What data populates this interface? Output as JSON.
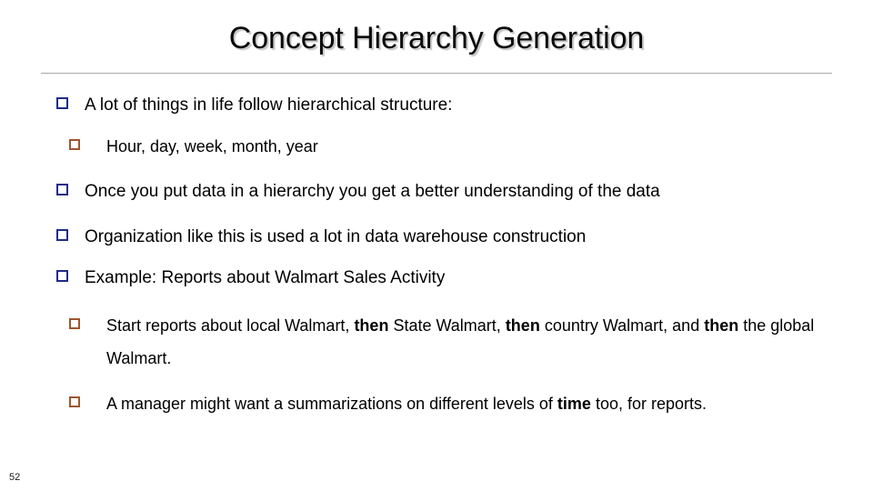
{
  "slide": {
    "title": "Concept Hierarchy Generation",
    "number": "52",
    "colors": {
      "background": "#ffffff",
      "text": "#000000",
      "title_text": "#0a0a0a",
      "title_shadow": "#969696",
      "rule": "#a8a8a8",
      "bullet_level1": "#1f2c87",
      "bullet_level2": "#a0562f"
    },
    "bullets": [
      {
        "level": 1,
        "marker": "hollow-square-blue",
        "text": "A lot of things in life follow hierarchical structure:"
      },
      {
        "level": 2,
        "marker": "hollow-square-brown",
        "text": "Hour, day, week, month, year"
      },
      {
        "level": 1,
        "marker": "hollow-square-blue",
        "text": "Once you put data in a hierarchy you get a better understanding of the data"
      },
      {
        "level": 1,
        "marker": "hollow-square-blue",
        "text": "Organization like this is used a lot in data warehouse construction"
      },
      {
        "level": 1,
        "marker": "hollow-square-blue",
        "text": "Example: Reports about Walmart Sales Activity"
      },
      {
        "level": 2,
        "marker": "hollow-square-brown",
        "text": "Start reports about local Walmart, then State Walmart, then country Walmart, and then the global Walmart.",
        "rich": [
          {
            "t": "Start reports about local Walmart, ",
            "bold": false
          },
          {
            "t": "then",
            "bold": true
          },
          {
            "t": " State Walmart, ",
            "bold": false
          },
          {
            "t": "then",
            "bold": true
          },
          {
            "t": " country Walmart, and ",
            "bold": false
          },
          {
            "t": "then",
            "bold": true
          },
          {
            "t": " the global Walmart.",
            "bold": false
          }
        ]
      },
      {
        "level": 2,
        "marker": "hollow-square-brown",
        "text": "A manager might want a summarizations on different levels of time too, for reports.",
        "rich": [
          {
            "t": "A manager might want a summarizations on different levels of ",
            "bold": false
          },
          {
            "t": "time",
            "bold": true
          },
          {
            "t": " too, for reports.",
            "bold": false
          }
        ]
      }
    ]
  }
}
